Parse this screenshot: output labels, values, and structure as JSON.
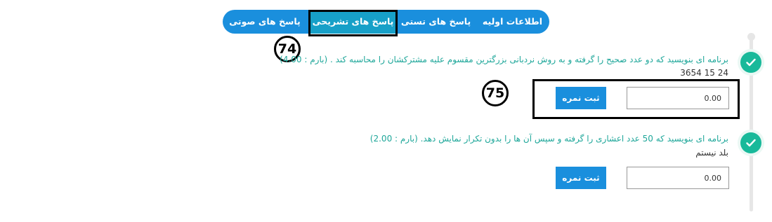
{
  "tabs": [
    {
      "label": "اطلاعات اولیه"
    },
    {
      "label": "پاسخ های تستی"
    },
    {
      "label": "پاسخ های تشریحی"
    },
    {
      "label": "پاسخ های صوتی"
    }
  ],
  "annotations": {
    "mark1": "74",
    "mark2": "75"
  },
  "questions": [
    {
      "text": "برنامه ای بنویسید که دو عدد صحیح را گرفته و به روش نردبانی بزرگترین مقسوم علیه مشترکشان را محاسبه کند . (بارم : 4.00)",
      "answer": "3654 15 24",
      "score_value": "0.00",
      "submit_label": "ثبت نمره"
    },
    {
      "text": "برنامه ای بنویسید که 50 عدد اعشاری را گرفته و سپس آن ها را بدون تکرار نمایش دهد. (بارم : 2.00)",
      "answer": "بلد نیستم",
      "score_value": "0.00",
      "submit_label": "ثبت نمره"
    }
  ],
  "colors": {
    "accent": "#1a8fdd",
    "check": "#18b99a",
    "question_text": "#1fa79a"
  },
  "icons": {
    "status": "check-icon"
  }
}
